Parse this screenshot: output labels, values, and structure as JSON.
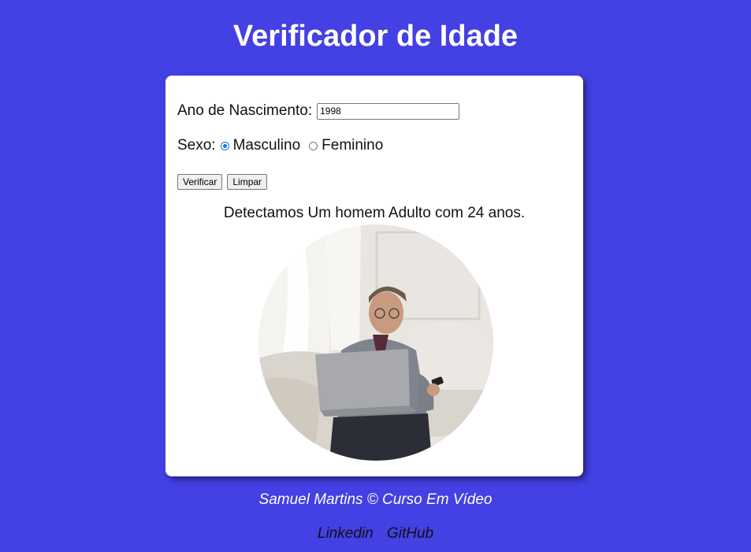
{
  "header": {
    "title": "Verificador de Idade"
  },
  "form": {
    "ano_label": "Ano de Nascimento:",
    "ano_value": "1998",
    "sexo_label": "Sexo:",
    "sexo_options": [
      "Masculino",
      "Feminino"
    ],
    "sexo_selected": "Masculino",
    "verify_label": "Verificar",
    "clear_label": "Limpar"
  },
  "result": {
    "text": "Detectamos Um homem Adulto com 24 anos.",
    "image": "adult-man-with-laptop-photo"
  },
  "footer": {
    "credit": "Samuel Martins © Curso Em Vídeo",
    "links": [
      "Linkedin",
      "GitHub"
    ]
  },
  "colors": {
    "background": "#4340e4",
    "card": "#ffffff",
    "radio_accent": "#0a75e8"
  }
}
